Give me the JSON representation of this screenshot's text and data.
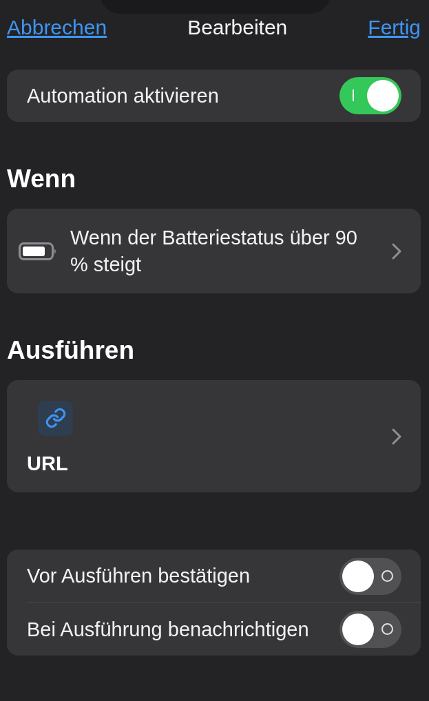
{
  "nav": {
    "cancel": "Abbrechen",
    "title": "Bearbeiten",
    "done": "Fertig"
  },
  "enable": {
    "label": "Automation aktivieren",
    "on": true
  },
  "trigger_section": {
    "heading": "Wenn",
    "trigger": {
      "text": "Wenn der Batteriestatus über 90 % steigt"
    }
  },
  "action_section": {
    "heading": "Ausführen",
    "action": {
      "label": "URL"
    }
  },
  "options": [
    {
      "label": "Vor Ausführen bestätigen",
      "on": false
    },
    {
      "label": "Bei Ausführung benachrichtigen",
      "on": false
    }
  ]
}
